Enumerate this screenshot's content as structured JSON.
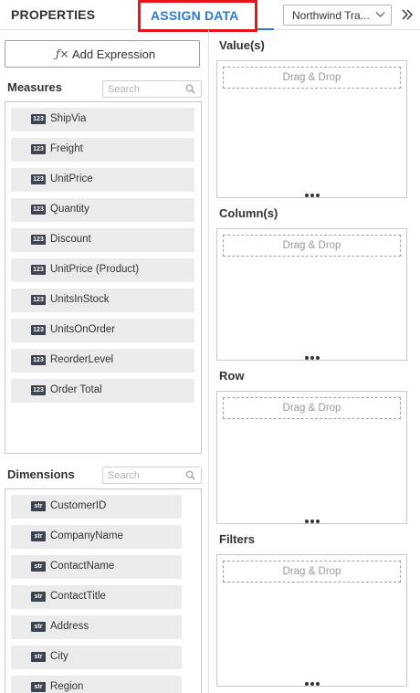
{
  "header": {
    "tab_properties": "PROPERTIES",
    "tab_assign_data": "ASSIGN DATA",
    "datasource_selected": "Northwind Tra...",
    "highlight_color": "#e8141b",
    "accent_color": "#2a7bd6"
  },
  "left": {
    "add_expression_icon": "ƒ×",
    "add_expression_label": "Add Expression",
    "measures": {
      "title": "Measures",
      "search_placeholder": "Search",
      "items": [
        {
          "type": "123",
          "label": "ShipVia"
        },
        {
          "type": "123",
          "label": "Freight"
        },
        {
          "type": "123",
          "label": "UnitPrice"
        },
        {
          "type": "123",
          "label": "Quantity"
        },
        {
          "type": "123",
          "label": "Discount"
        },
        {
          "type": "123",
          "label": "UnitPrice (Product)"
        },
        {
          "type": "123",
          "label": "UnitsInStock"
        },
        {
          "type": "123",
          "label": "UnitsOnOrder"
        },
        {
          "type": "123",
          "label": "ReorderLevel"
        },
        {
          "type": "123",
          "label": "Order Total"
        }
      ]
    },
    "dimensions": {
      "title": "Dimensions",
      "search_placeholder": "Search",
      "items": [
        {
          "type": "str",
          "label": "CustomerID"
        },
        {
          "type": "str",
          "label": "CompanyName"
        },
        {
          "type": "str",
          "label": "ContactName"
        },
        {
          "type": "str",
          "label": "ContactTitle"
        },
        {
          "type": "str",
          "label": "Address"
        },
        {
          "type": "str",
          "label": "City"
        },
        {
          "type": "str",
          "label": "Region"
        }
      ]
    }
  },
  "right": {
    "sections": [
      {
        "title": "Value(s)",
        "drop_label": "Drag & Drop"
      },
      {
        "title": "Column(s)",
        "drop_label": "Drag & Drop"
      },
      {
        "title": "Row",
        "drop_label": "Drag & Drop"
      },
      {
        "title": "Filters",
        "drop_label": "Drag & Drop"
      }
    ]
  }
}
